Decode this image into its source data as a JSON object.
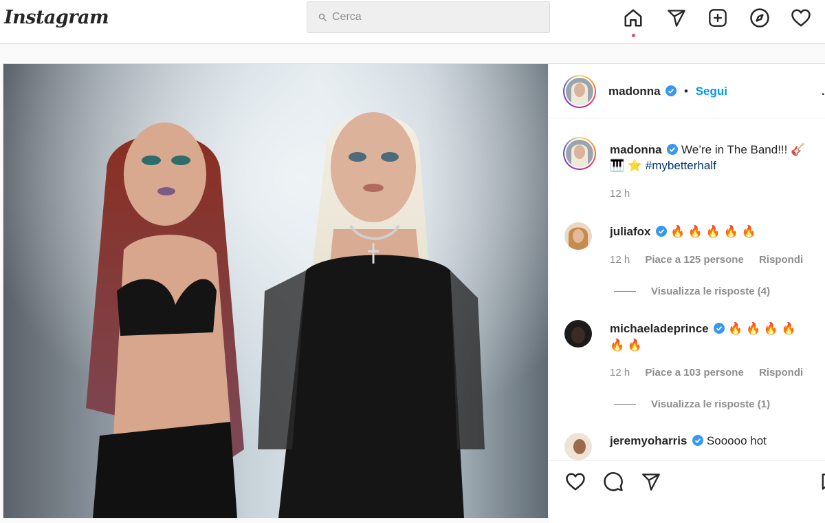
{
  "app": {
    "logo": "Instagram"
  },
  "search": {
    "placeholder": "Cerca"
  },
  "nav": {
    "icons": [
      "home-icon",
      "direct-icon",
      "new-post-icon",
      "explore-icon",
      "activity-icon"
    ]
  },
  "post": {
    "header": {
      "username": "madonna",
      "separator": "•",
      "follow_label": "Segui",
      "more": "..."
    },
    "caption": {
      "username": "madonna",
      "text": "We’re in The Band!!! 🎸",
      "line2_emoji": "🎹 ⭐",
      "hashtag": "#mybetterhalf",
      "time": "12 h"
    },
    "comments": [
      {
        "username": "juliafox",
        "text": "🔥 🔥 🔥 🔥 🔥",
        "time": "12 h",
        "likes": "Piace a 125 persone",
        "reply": "Rispondi",
        "view_replies": "Visualizza le risposte (4)"
      },
      {
        "username": "michaeladeprince",
        "text": "🔥 🔥 🔥 🔥",
        "text2": "🔥 🔥",
        "time": "12 h",
        "likes": "Piace a 103 persone",
        "reply": "Rispondi",
        "view_replies": "Visualizza le risposte (1)"
      },
      {
        "username": "jeremyoharris",
        "text": "Sooooo hot"
      }
    ]
  },
  "colors": {
    "accent": "#0095f6",
    "verified": "#3897f0",
    "notification": "#ed4956"
  }
}
